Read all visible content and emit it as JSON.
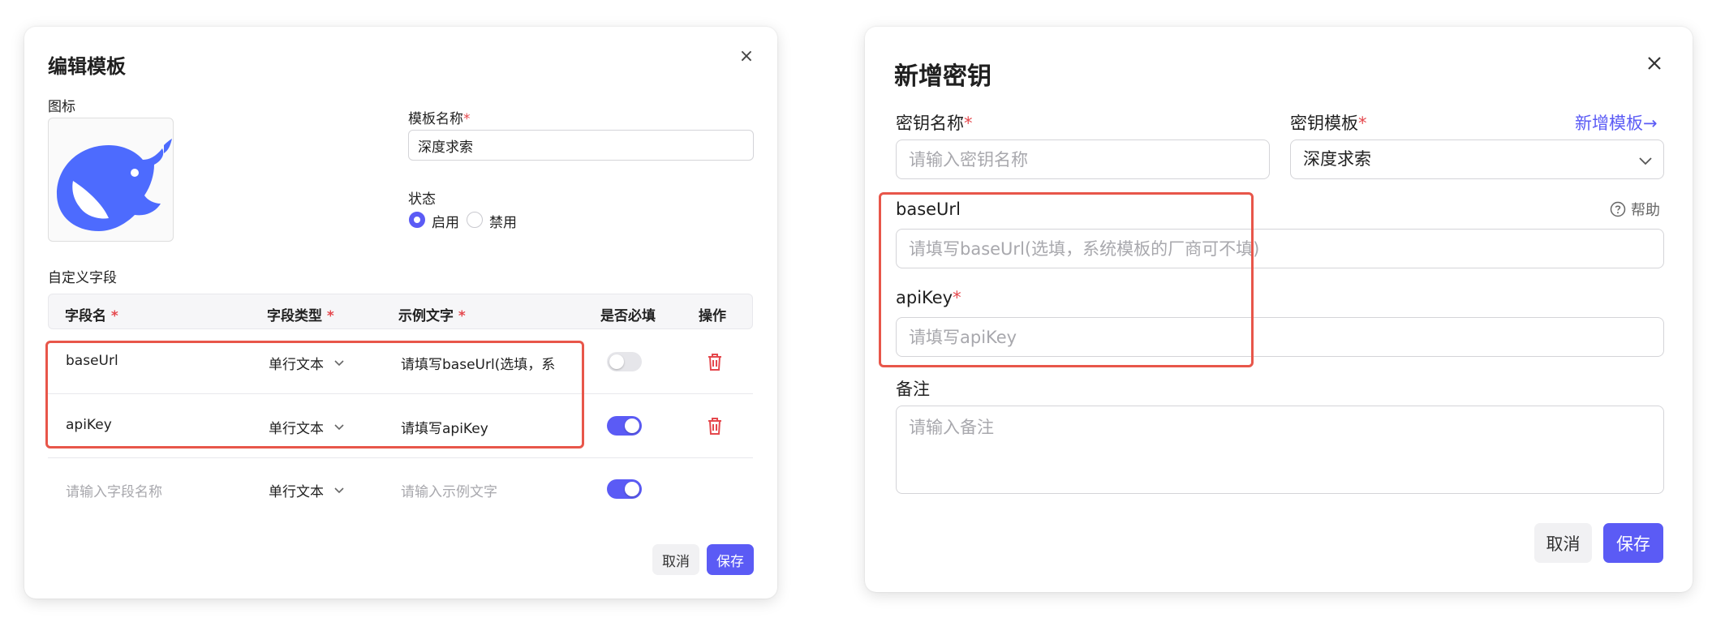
{
  "edit_template_dialog": {
    "title": "编辑模板",
    "close_label": "×",
    "icon_label": "图标",
    "template_name_label": "模板名称",
    "template_name_value": "深度求索",
    "status_label": "状态",
    "status_enabled": "启用",
    "status_disabled": "禁用",
    "status_selected": "启用",
    "custom_fields_label": "自定义字段",
    "columns": {
      "field_name": "字段名",
      "field_type": "字段类型",
      "example_text": "示例文字",
      "required": "是否必填",
      "actions": "操作"
    },
    "required_mark": "*",
    "rows": [
      {
        "name": "baseUrl",
        "type": "单行文本",
        "example": "请填写baseUrl(选填，系",
        "required": false
      },
      {
        "name": "apiKey",
        "type": "单行文本",
        "example": "请填写apiKey",
        "required": true
      }
    ],
    "new_row": {
      "name_placeholder": "请输入字段名称",
      "type": "单行文本",
      "example_placeholder": "请输入示例文字",
      "required": true
    },
    "cancel_label": "取消",
    "save_label": "保存"
  },
  "new_key_dialog": {
    "title": "新增密钥",
    "close_label": "✕",
    "key_name_label": "密钥名称",
    "key_name_placeholder": "请输入密钥名称",
    "key_template_label": "密钥模板",
    "key_template_value": "深度求索",
    "add_template_link": "新增模板",
    "link_arrow": "→",
    "base_url_label": "baseUrl",
    "help_label": "帮助",
    "base_url_placeholder": "请填写baseUrl(选填，系统模板的厂商可不填)",
    "api_key_label": "apiKey",
    "api_key_placeholder": "请填写apiKey",
    "remark_label": "备注",
    "remark_placeholder": "请输入备注",
    "required_mark": "*",
    "cancel_label": "取消",
    "save_label": "保存"
  },
  "colors": {
    "accent": "#5b5bf5",
    "danger": "#e5484d",
    "highlight": "#e8564a",
    "deepseek_blue": "#4d6bfe"
  },
  "icons": [
    "deepseek-whale-logo",
    "close-icon",
    "chevron-down-icon",
    "trash-icon",
    "help-circle-icon",
    "arrow-right-icon"
  ]
}
